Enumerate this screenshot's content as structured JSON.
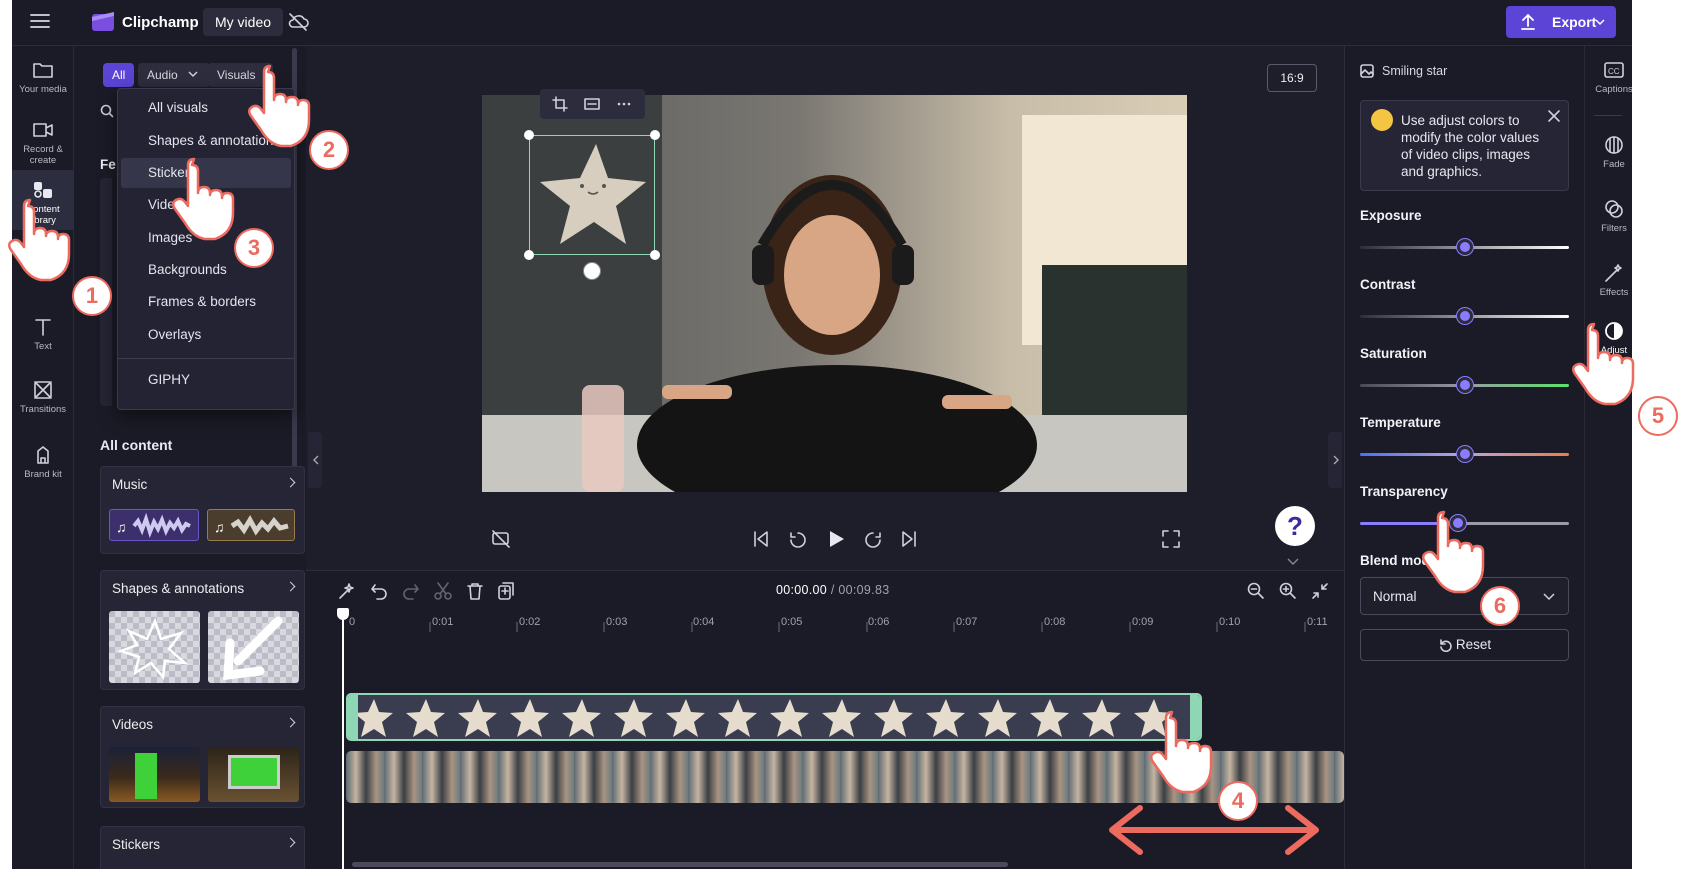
{
  "header": {
    "app_name": "Clipchamp",
    "video_name": "My video",
    "export_label": "Export"
  },
  "left_rail": [
    {
      "label": "Your media",
      "icon": "folder-icon"
    },
    {
      "label": "Record & create",
      "icon": "camera-icon"
    },
    {
      "label": "Content library",
      "icon": "shapes-icon"
    },
    {
      "label": "Text",
      "icon": "text-icon"
    },
    {
      "label": "Transitions",
      "icon": "transitions-icon"
    },
    {
      "label": "Brand kit",
      "icon": "brand-kit-icon"
    }
  ],
  "library": {
    "filters": {
      "all": "All",
      "audio": "Audio",
      "visuals": "Visuals"
    },
    "featured_partial": "Fe",
    "dropdown": [
      "All visuals",
      "Shapes & annotations",
      "Stickers",
      "Videos",
      "Images",
      "Backgrounds",
      "Frames & borders",
      "Overlays"
    ],
    "dropdown_extra": "GIPHY",
    "section_title": "All content",
    "cards": {
      "music": "Music",
      "shapes": "Shapes & annotations",
      "videos": "Videos",
      "stickers": "Stickers"
    }
  },
  "preview": {
    "aspect_ratio": "16:9",
    "help_label": "?"
  },
  "timeline": {
    "current_time": "00:00.00",
    "total_time": "00:09.83",
    "ticks": [
      "0",
      "0:01",
      "0:02",
      "0:03",
      "0:04",
      "0:05",
      "0:06",
      "0:07",
      "0:08",
      "0:09",
      "0:10",
      "0:11"
    ]
  },
  "properties": {
    "asset_name": "Smiling star",
    "tip_text": "Use adjust colors to modify the color values of video clips, images and graphics.",
    "sliders": [
      {
        "label": "Exposure",
        "value": 0.5
      },
      {
        "label": "Contrast",
        "value": 0.5
      },
      {
        "label": "Saturation",
        "value": 0.5
      },
      {
        "label": "Temperature",
        "value": 0.5
      },
      {
        "label": "Transparency",
        "value": 0.47
      }
    ],
    "blend_mode_label": "Blend mode",
    "blend_mode_value": "Normal",
    "reset_label": "Reset"
  },
  "right_rail": [
    {
      "label": "Captions",
      "icon": "captions-icon"
    },
    {
      "label": "Fade",
      "icon": "fade-icon"
    },
    {
      "label": "Filters",
      "icon": "filters-icon"
    },
    {
      "label": "Effects",
      "icon": "effects-icon"
    },
    {
      "label": "Adjust colors",
      "icon": "adjust-colors-icon"
    }
  ],
  "steps": [
    "1",
    "2",
    "3",
    "4",
    "5",
    "6"
  ],
  "colors": {
    "accent": "#5b44d6",
    "annotation": "#ec6a5e",
    "selection": "#8fd6b5"
  }
}
